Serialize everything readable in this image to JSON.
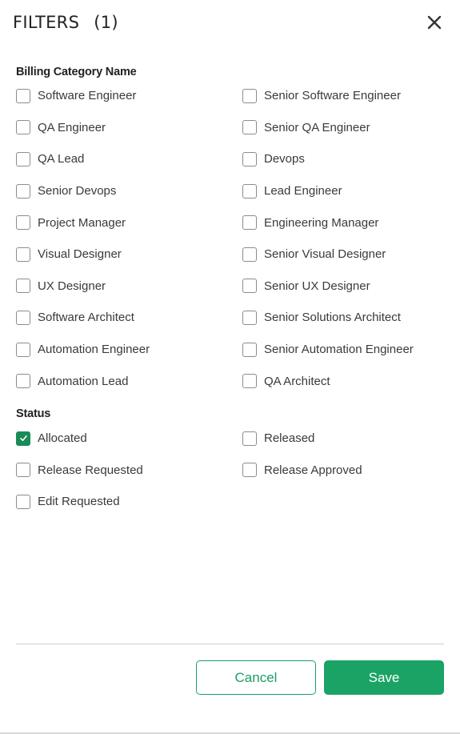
{
  "header": {
    "title": "FILTERS",
    "count": "(1)",
    "close_icon": "close-icon"
  },
  "billing": {
    "label": "Billing Category Name",
    "options": [
      {
        "label": "Software Engineer",
        "checked": false
      },
      {
        "label": "Senior Software Engineer",
        "checked": false
      },
      {
        "label": "QA Engineer",
        "checked": false
      },
      {
        "label": "Senior QA Engineer",
        "checked": false
      },
      {
        "label": "QA Lead",
        "checked": false
      },
      {
        "label": "Devops",
        "checked": false
      },
      {
        "label": "Senior Devops",
        "checked": false
      },
      {
        "label": "Lead Engineer",
        "checked": false
      },
      {
        "label": "Project Manager",
        "checked": false
      },
      {
        "label": "Engineering Manager",
        "checked": false
      },
      {
        "label": "Visual Designer",
        "checked": false
      },
      {
        "label": "Senior Visual Designer",
        "checked": false
      },
      {
        "label": "UX Designer",
        "checked": false
      },
      {
        "label": "Senior UX Designer",
        "checked": false
      },
      {
        "label": "Software Architect",
        "checked": false
      },
      {
        "label": "Senior Solutions Architect",
        "checked": false
      },
      {
        "label": "Automation Engineer",
        "checked": false
      },
      {
        "label": "Senior Automation Engineer",
        "checked": false
      },
      {
        "label": "Automation Lead",
        "checked": false
      },
      {
        "label": "QA Architect",
        "checked": false
      }
    ]
  },
  "status": {
    "label": "Status",
    "options": [
      {
        "label": "Allocated",
        "checked": true
      },
      {
        "label": "Released",
        "checked": false
      },
      {
        "label": "Release Requested",
        "checked": false
      },
      {
        "label": "Release Approved",
        "checked": false
      },
      {
        "label": "Edit Requested",
        "checked": false
      }
    ]
  },
  "footer": {
    "cancel_label": "Cancel",
    "save_label": "Save"
  },
  "colors": {
    "accent": "#1aa364",
    "checkbox_checked": "#1a8b57",
    "checkbox_border": "#8c8c8c",
    "divider": "#cfcfcf"
  }
}
